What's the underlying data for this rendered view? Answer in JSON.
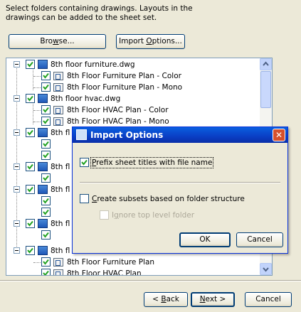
{
  "instruction": {
    "line1": "Select folders containing drawings.  Layouts in the",
    "line2": "drawings can be added to the sheet set."
  },
  "buttons": {
    "browse": {
      "pre": "Bro",
      "u": "w",
      "post": "se..."
    },
    "import_options": {
      "pre": "Import ",
      "u": "O",
      "post": "ptions..."
    }
  },
  "tree": {
    "folders": [
      {
        "label": "8th floor furniture.dwg",
        "children": [
          "8th Floor Furniture Plan - Color",
          "8th Floor Furniture Plan - Mono"
        ]
      },
      {
        "label": "8th floor hvac.dwg",
        "children": [
          "8th Floor HVAC Plan - Color",
          "8th Floor HVAC Plan - Mono"
        ]
      },
      {
        "label": "8th fl"
      },
      {
        "label": "8th fl"
      },
      {
        "label": "8th fl"
      },
      {
        "label": "8th fl"
      },
      {
        "label": "8th fl"
      }
    ],
    "bottom_children": [
      "8th Floor Furniture Plan",
      "8th Floor HVAC Plan"
    ]
  },
  "dialog": {
    "title": "Import Options",
    "prefix": {
      "u": "P",
      "post": "refix sheet titles with file name",
      "checked": true
    },
    "subsets": {
      "u": "C",
      "post": "reate subsets based on folder structure",
      "checked": false
    },
    "ignore": {
      "pre": "I",
      "u": "g",
      "post": "nore top level folder",
      "checked": false,
      "disabled": true
    },
    "ok": "OK",
    "cancel": "Cancel"
  },
  "footer": {
    "back": {
      "pre": "< ",
      "u": "B",
      "post": "ack"
    },
    "next": {
      "u": "N",
      "post": "ext >"
    },
    "cancel": "Cancel"
  },
  "colors": {
    "titlebar": "#0a3ec4",
    "check": "#21a121",
    "window_bg": "#ece9d8"
  },
  "icons": [
    "checkbox-checked-icon",
    "drawing-file-icon",
    "layout-icon",
    "collapse-minus-icon",
    "scroll-up-arrow-icon",
    "scroll-down-arrow-icon",
    "close-icon",
    "import-options-icon"
  ]
}
